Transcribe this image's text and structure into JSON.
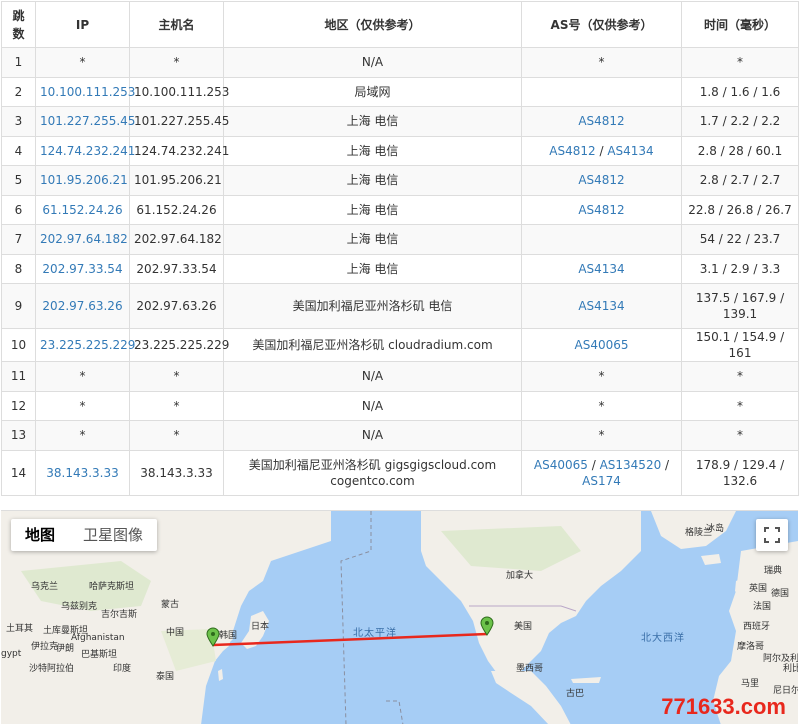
{
  "table": {
    "headers": [
      "跳数",
      "IP",
      "主机名",
      "地区（仅供参考）",
      "AS号（仅供参考）",
      "时间（毫秒）"
    ],
    "rows": [
      {
        "hop": "1",
        "ip": "*",
        "host": "*",
        "region": "N/A",
        "as": [
          {
            "t": "*",
            "link": false
          }
        ],
        "time": "*"
      },
      {
        "hop": "2",
        "ip": "10.100.111.253",
        "host": "10.100.111.253",
        "region": "局域网",
        "as": [],
        "time": "1.8 / 1.6 / 1.6"
      },
      {
        "hop": "3",
        "ip": "101.227.255.45",
        "host": "101.227.255.45",
        "region": "上海 电信",
        "as": [
          {
            "t": "AS4812",
            "link": true
          }
        ],
        "time": "1.7 / 2.2 / 2.2"
      },
      {
        "hop": "4",
        "ip": "124.74.232.241",
        "host": "124.74.232.241",
        "region": "上海 电信",
        "as": [
          {
            "t": "AS4812",
            "link": true
          },
          {
            "t": "AS4134",
            "link": true
          }
        ],
        "time": "2.8 / 28 / 60.1"
      },
      {
        "hop": "5",
        "ip": "101.95.206.21",
        "host": "101.95.206.21",
        "region": "上海 电信",
        "as": [
          {
            "t": "AS4812",
            "link": true
          }
        ],
        "time": "2.8 / 2.7 / 2.7"
      },
      {
        "hop": "6",
        "ip": "61.152.24.26",
        "host": "61.152.24.26",
        "region": "上海 电信",
        "as": [
          {
            "t": "AS4812",
            "link": true
          }
        ],
        "time": "22.8 / 26.8 / 26.7"
      },
      {
        "hop": "7",
        "ip": "202.97.64.182",
        "host": "202.97.64.182",
        "region": "上海 电信",
        "as": [],
        "time": "54 / 22 / 23.7"
      },
      {
        "hop": "8",
        "ip": "202.97.33.54",
        "host": "202.97.33.54",
        "region": "上海 电信",
        "as": [
          {
            "t": "AS4134",
            "link": true
          }
        ],
        "time": "3.1 / 2.9 / 3.3"
      },
      {
        "hop": "9",
        "ip": "202.97.63.26",
        "host": "202.97.63.26",
        "region": "美国加利福尼亚州洛杉矶 电信",
        "as": [
          {
            "t": "AS4134",
            "link": true
          }
        ],
        "time": "137.5 / 167.9 / 139.1",
        "tall": true
      },
      {
        "hop": "10",
        "ip": "23.225.225.229",
        "host": "23.225.225.229",
        "region": "美国加利福尼亚州洛杉矶 cloudradium.com",
        "as": [
          {
            "t": "AS40065",
            "link": true
          }
        ],
        "time": "150.1 / 154.9 / 161"
      },
      {
        "hop": "11",
        "ip": "*",
        "host": "*",
        "region": "N/A",
        "as": [
          {
            "t": "*",
            "link": false
          }
        ],
        "time": "*"
      },
      {
        "hop": "12",
        "ip": "*",
        "host": "*",
        "region": "N/A",
        "as": [
          {
            "t": "*",
            "link": false
          }
        ],
        "time": "*"
      },
      {
        "hop": "13",
        "ip": "*",
        "host": "*",
        "region": "N/A",
        "as": [
          {
            "t": "*",
            "link": false
          }
        ],
        "time": "*"
      },
      {
        "hop": "14",
        "ip": "38.143.3.33",
        "host": "38.143.3.33",
        "region": "美国加利福尼亚州洛杉矶 gigsgigscloud.com cogentco.com",
        "as": [
          {
            "t": "AS40065",
            "link": true
          },
          {
            "t": "AS134520",
            "link": true
          },
          {
            "t": "AS174",
            "link": true
          }
        ],
        "time": "178.9 / 129.4 / 132.6",
        "tall": true
      }
    ]
  },
  "map": {
    "tab_map": "地图",
    "tab_satellite": "卫星图像",
    "labels": {
      "north_pacific": "北太平洋",
      "north_atlantic": "北大西洋",
      "canada": "加拿大",
      "usa": "美国",
      "mexico": "墨西哥",
      "greenland": "格陵兰",
      "iceland": "冰岛",
      "uk": "英国",
      "germany": "德国",
      "france": "法国",
      "spain": "西班牙",
      "sweden": "瑞典",
      "ukraine": "乌克兰",
      "kazakhstan": "哈萨克斯坦",
      "mongolia": "蒙古",
      "china": "中国",
      "japan": "日本",
      "korea": "韩国",
      "afghanistan": "Afghanistan",
      "iran": "伊朗",
      "iraq": "伊拉克",
      "pakistan": "巴基斯坦",
      "india": "印度",
      "thailand": "泰国",
      "saudi": "沙特阿拉伯",
      "turkey": "土耳其",
      "egypt": "gypt",
      "turkmenistan": "土库曼斯坦",
      "cuba": "古巴",
      "morocco": "摩洛哥",
      "algeria": "阿尔及利亚",
      "mali": "马里",
      "niger": "尼日尔",
      "libya": "利比亚",
      "uzbekistan": "乌兹别克",
      "kyrgyz": "吉尔吉斯"
    },
    "route_color": "#e8281d",
    "pin_color": "#6cc24a"
  },
  "watermark": "771633.com"
}
